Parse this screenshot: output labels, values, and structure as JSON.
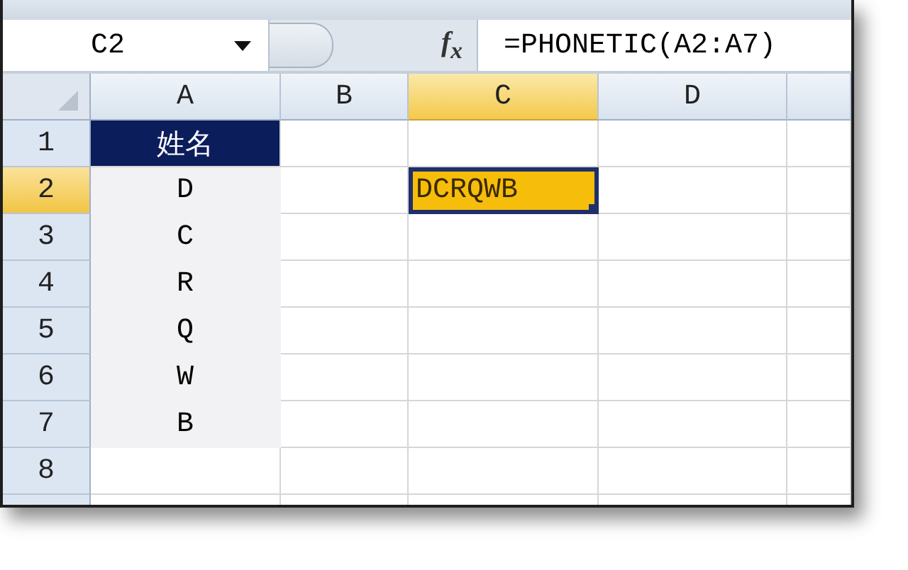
{
  "name_box": {
    "value": "C2"
  },
  "formula_bar": {
    "function_label": "f$_{x}$",
    "formula": "=PHONETIC(A2:A7)"
  },
  "columns": [
    {
      "label": "A",
      "selected": false
    },
    {
      "label": "B",
      "selected": false
    },
    {
      "label": "C",
      "selected": true
    },
    {
      "label": "D",
      "selected": false
    }
  ],
  "rows": [
    {
      "label": "1",
      "selected": false,
      "cells": [
        {
          "kind": "header",
          "text": "姓名",
          "selected": false
        },
        {
          "kind": "blank",
          "selected": false
        },
        {
          "kind": "blank",
          "selected": false
        },
        {
          "kind": "blank",
          "selected": false
        }
      ]
    },
    {
      "label": "2",
      "selected": true,
      "cells": [
        {
          "kind": "shaded",
          "text": "D",
          "selected": false
        },
        {
          "kind": "blank",
          "selected": false
        },
        {
          "kind": "blank",
          "text": "DCRQWB",
          "selected": true
        },
        {
          "kind": "blank",
          "selected": false
        }
      ]
    },
    {
      "label": "3",
      "selected": false,
      "cells": [
        {
          "kind": "shaded",
          "text": "C",
          "selected": false
        },
        {
          "kind": "blank",
          "selected": false
        },
        {
          "kind": "blank",
          "selected": false
        },
        {
          "kind": "blank",
          "selected": false
        }
      ]
    },
    {
      "label": "4",
      "selected": false,
      "cells": [
        {
          "kind": "shaded",
          "text": "R",
          "selected": false
        },
        {
          "kind": "blank",
          "selected": false
        },
        {
          "kind": "blank",
          "selected": false
        },
        {
          "kind": "blank",
          "selected": false
        }
      ]
    },
    {
      "label": "5",
      "selected": false,
      "cells": [
        {
          "kind": "shaded",
          "text": "Q",
          "selected": false
        },
        {
          "kind": "blank",
          "selected": false
        },
        {
          "kind": "blank",
          "selected": false
        },
        {
          "kind": "blank",
          "selected": false
        }
      ]
    },
    {
      "label": "6",
      "selected": false,
      "cells": [
        {
          "kind": "shaded",
          "text": "W",
          "selected": false
        },
        {
          "kind": "blank",
          "selected": false
        },
        {
          "kind": "blank",
          "selected": false
        },
        {
          "kind": "blank",
          "selected": false
        }
      ]
    },
    {
      "label": "7",
      "selected": false,
      "cells": [
        {
          "kind": "shaded",
          "text": "B",
          "selected": false
        },
        {
          "kind": "blank",
          "selected": false
        },
        {
          "kind": "blank",
          "selected": false
        },
        {
          "kind": "blank",
          "selected": false
        }
      ]
    },
    {
      "label": "8",
      "selected": false,
      "cells": [
        {
          "kind": "blank",
          "selected": false
        },
        {
          "kind": "blank",
          "selected": false
        },
        {
          "kind": "blank",
          "selected": false
        },
        {
          "kind": "blank",
          "selected": false
        }
      ]
    }
  ]
}
